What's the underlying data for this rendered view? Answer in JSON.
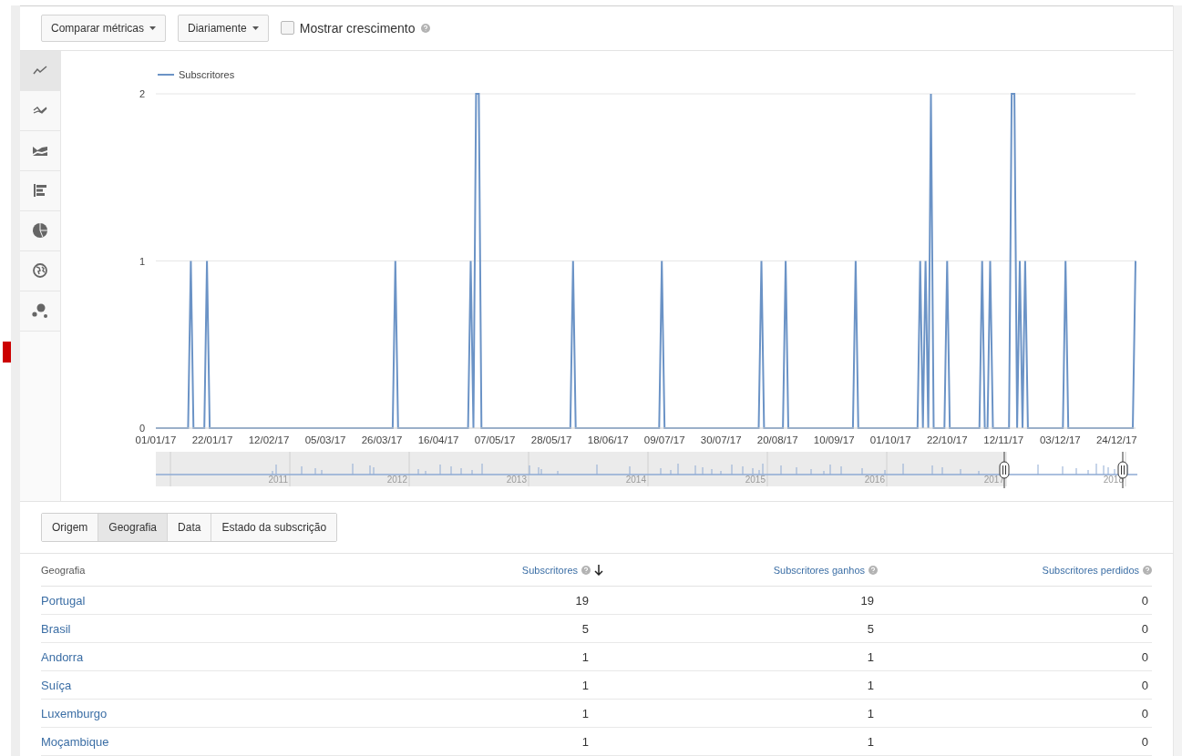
{
  "toolbar": {
    "compare": "Comparar métricas",
    "period": "Diariamente",
    "growth": {
      "label": "Mostrar crescimento",
      "checked": false
    }
  },
  "chart_types": [
    {
      "kind": "line",
      "selected": true
    },
    {
      "kind": "compare",
      "selected": false
    },
    {
      "kind": "area",
      "selected": false
    },
    {
      "kind": "bar",
      "selected": false
    },
    {
      "kind": "pie",
      "selected": false
    },
    {
      "kind": "map",
      "selected": false
    },
    {
      "kind": "bubble",
      "selected": false
    }
  ],
  "chart": {
    "chart_data": {
      "type": "line",
      "ylim": [
        0,
        2
      ],
      "yticks": [
        0,
        1,
        2
      ],
      "categories": [
        "01/01/17",
        null,
        null,
        null,
        null,
        null,
        null,
        null,
        null,
        null,
        null,
        null,
        null,
        null,
        null,
        null,
        null,
        null,
        null,
        null,
        null,
        "22/01/17",
        null,
        null,
        null,
        null,
        null,
        null,
        null,
        null,
        null,
        null,
        null,
        null,
        null,
        null,
        null,
        null,
        null,
        null,
        null,
        null,
        "12/02/17",
        null,
        null,
        null,
        null,
        null,
        null,
        null,
        null,
        null,
        null,
        null,
        null,
        null,
        null,
        null,
        null,
        null,
        null,
        null,
        null,
        "05/03/17",
        null,
        null,
        null,
        null,
        null,
        null,
        null,
        null,
        null,
        null,
        null,
        null,
        null,
        null,
        null,
        null,
        null,
        null,
        null,
        null,
        "26/03/17",
        null,
        null,
        null,
        null,
        null,
        null,
        null,
        null,
        null,
        null,
        null,
        null,
        null,
        null,
        null,
        null,
        null,
        null,
        null,
        null,
        "16/04/17",
        null,
        null,
        null,
        null,
        null,
        null,
        null,
        null,
        null,
        null,
        null,
        null,
        null,
        null,
        null,
        null,
        null,
        null,
        null,
        null,
        "07/05/17",
        null,
        null,
        null,
        null,
        null,
        null,
        null,
        null,
        null,
        null,
        null,
        null,
        null,
        null,
        null,
        null,
        null,
        null,
        null,
        null,
        "28/05/17",
        null,
        null,
        null,
        null,
        null,
        null,
        null,
        null,
        null,
        null,
        null,
        null,
        null,
        null,
        null,
        null,
        null,
        null,
        null,
        null,
        "18/06/17",
        null,
        null,
        null,
        null,
        null,
        null,
        null,
        null,
        null,
        null,
        null,
        null,
        null,
        null,
        null,
        null,
        null,
        null,
        null,
        null,
        "09/07/17",
        null,
        null,
        null,
        null,
        null,
        null,
        null,
        null,
        null,
        null,
        null,
        null,
        null,
        null,
        null,
        null,
        null,
        null,
        null,
        null,
        "30/07/17",
        null,
        null,
        null,
        null,
        null,
        null,
        null,
        null,
        null,
        null,
        null,
        null,
        null,
        null,
        null,
        null,
        null,
        null,
        null,
        null,
        "20/08/17",
        null,
        null,
        null,
        null,
        null,
        null,
        null,
        null,
        null,
        null,
        null,
        null,
        null,
        null,
        null,
        null,
        null,
        null,
        null,
        null,
        "10/09/17",
        null,
        null,
        null,
        null,
        null,
        null,
        null,
        null,
        null,
        null,
        null,
        null,
        null,
        null,
        null,
        null,
        null,
        null,
        null,
        null,
        "01/10/17",
        null,
        null,
        null,
        null,
        null,
        null,
        null,
        null,
        null,
        null,
        null,
        null,
        null,
        null,
        null,
        null,
        null,
        null,
        null,
        null,
        "22/10/17",
        null,
        null,
        null,
        null,
        null,
        null,
        null,
        null,
        null,
        null,
        null,
        null,
        null,
        null,
        null,
        null,
        null,
        null,
        null,
        null,
        "12/11/17",
        null,
        null,
        null,
        null,
        null,
        null,
        null,
        null,
        null,
        null,
        null,
        null,
        null,
        null,
        null,
        null,
        null,
        null,
        null,
        null,
        "03/12/17",
        null,
        null,
        null,
        null,
        null,
        null,
        null,
        null,
        null,
        null,
        null,
        null,
        null,
        null,
        null,
        null,
        null,
        null,
        null,
        null,
        "24/12/17",
        null,
        null,
        null,
        null,
        null,
        null,
        null
      ],
      "series": [
        {
          "name": "Subscritores",
          "color": "#6b93c6",
          "values": [
            0,
            0,
            0,
            0,
            0,
            0,
            0,
            0,
            0,
            0,
            0,
            0,
            0,
            1,
            0,
            0,
            0,
            0,
            0,
            1,
            0,
            0,
            0,
            0,
            0,
            0,
            0,
            0,
            0,
            0,
            0,
            0,
            0,
            0,
            0,
            0,
            0,
            0,
            0,
            0,
            0,
            0,
            0,
            0,
            0,
            0,
            0,
            0,
            0,
            0,
            0,
            0,
            0,
            0,
            0,
            0,
            0,
            0,
            0,
            0,
            0,
            0,
            0,
            0,
            0,
            0,
            0,
            0,
            0,
            0,
            0,
            0,
            0,
            0,
            0,
            0,
            0,
            0,
            0,
            0,
            0,
            0,
            0,
            0,
            0,
            0,
            0,
            0,
            0,
            1,
            0,
            0,
            0,
            0,
            0,
            0,
            0,
            0,
            0,
            0,
            0,
            0,
            0,
            0,
            0,
            0,
            0,
            0,
            0,
            0,
            0,
            0,
            0,
            0,
            0,
            0,
            0,
            1,
            0,
            2,
            2,
            0,
            0,
            0,
            0,
            0,
            0,
            0,
            0,
            0,
            0,
            0,
            0,
            0,
            0,
            0,
            0,
            0,
            0,
            0,
            0,
            0,
            0,
            0,
            0,
            0,
            0,
            0,
            0,
            0,
            0,
            0,
            0,
            0,
            0,
            1,
            0,
            0,
            0,
            0,
            0,
            0,
            0,
            0,
            0,
            0,
            0,
            0,
            0,
            0,
            0,
            0,
            0,
            0,
            0,
            0,
            0,
            0,
            0,
            0,
            0,
            0,
            0,
            0,
            0,
            0,
            0,
            0,
            1,
            0,
            0,
            0,
            0,
            0,
            0,
            0,
            0,
            0,
            0,
            0,
            0,
            0,
            0,
            0,
            0,
            0,
            0,
            0,
            0,
            0,
            0,
            0,
            0,
            0,
            0,
            0,
            0,
            0,
            0,
            0,
            0,
            0,
            0,
            0,
            0,
            1,
            0,
            0,
            0,
            0,
            0,
            0,
            0,
            0,
            1,
            0,
            0,
            0,
            0,
            0,
            0,
            0,
            0,
            0,
            0,
            0,
            0,
            0,
            0,
            0,
            0,
            0,
            0,
            0,
            0,
            0,
            0,
            0,
            0,
            0,
            1,
            0,
            0,
            0,
            0,
            0,
            0,
            0,
            0,
            0,
            0,
            0,
            0,
            0,
            0,
            0,
            0,
            0,
            0,
            0,
            0,
            0,
            0,
            0,
            1,
            0,
            1,
            0,
            2,
            0,
            0,
            0,
            0,
            0,
            1,
            0,
            0,
            0,
            0,
            0,
            0,
            0,
            0,
            0,
            0,
            0,
            0,
            1,
            0,
            0,
            1,
            0,
            0,
            0,
            0,
            0,
            0,
            0,
            2,
            2,
            0,
            1,
            0,
            1,
            0,
            0,
            0,
            0,
            0,
            0,
            0,
            0,
            0,
            0,
            0,
            0,
            0,
            0,
            1,
            0,
            0,
            0,
            0,
            0,
            0,
            0,
            0,
            0,
            0,
            0,
            0,
            0,
            0,
            0,
            0,
            0,
            0,
            0,
            0,
            0,
            0,
            0,
            0,
            0,
            1
          ]
        }
      ]
    }
  },
  "navigator": {
    "years": [
      "2011",
      "2012",
      "2013",
      "2014",
      "2015",
      "2016",
      "2017",
      "2018"
    ]
  },
  "tabs": [
    {
      "label": "Origem",
      "selected": false
    },
    {
      "label": "Geografia",
      "selected": true
    },
    {
      "label": "Data",
      "selected": false
    },
    {
      "label": "Estado da subscrição",
      "selected": false
    }
  ],
  "table": {
    "columns": [
      {
        "label": "Geografia",
        "help": false,
        "sorted": false
      },
      {
        "label": "Subscritores",
        "help": true,
        "sorted": true
      },
      {
        "label": "Subscritores ganhos",
        "help": true,
        "sorted": false
      },
      {
        "label": "Subscritores perdidos",
        "help": true,
        "sorted": false
      }
    ],
    "rows": [
      {
        "cells": [
          "Portugal",
          "19",
          "19",
          "0"
        ]
      },
      {
        "cells": [
          "Brasil",
          "5",
          "5",
          "0"
        ]
      },
      {
        "cells": [
          "Andorra",
          "1",
          "1",
          "0"
        ]
      },
      {
        "cells": [
          "Suíça",
          "1",
          "1",
          "0"
        ]
      },
      {
        "cells": [
          "Luxemburgo",
          "1",
          "1",
          "0"
        ]
      },
      {
        "cells": [
          "Moçambique",
          "1",
          "1",
          "0"
        ]
      }
    ]
  }
}
